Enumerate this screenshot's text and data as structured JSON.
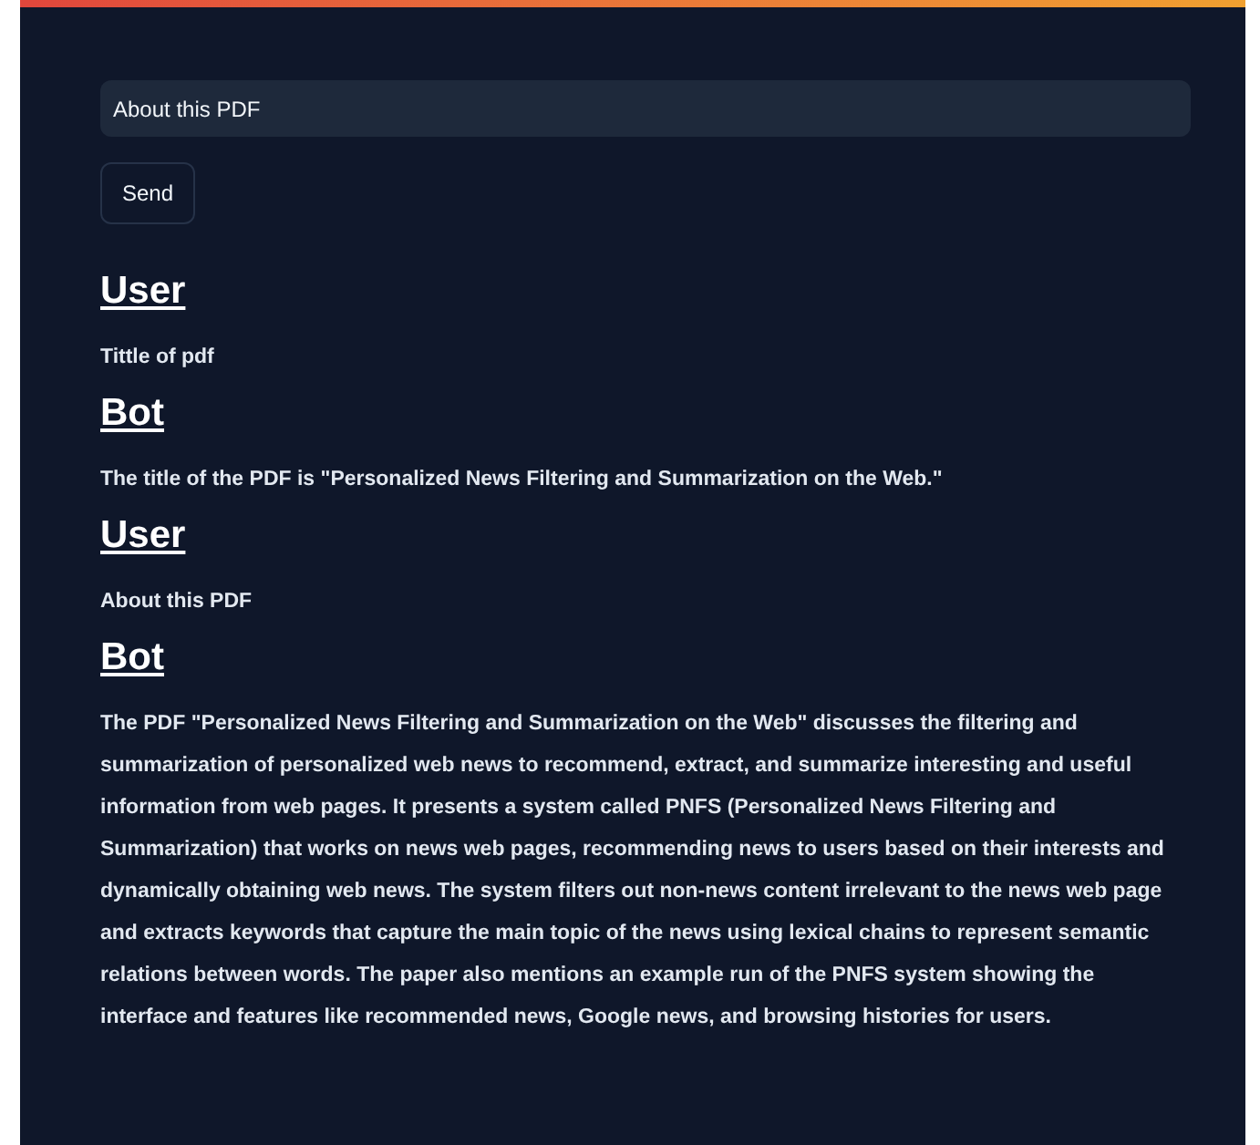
{
  "input": {
    "value": "About this PDF"
  },
  "send_button": {
    "label": "Send"
  },
  "messages": [
    {
      "speaker": "User",
      "text": "Tittle of pdf"
    },
    {
      "speaker": "Bot",
      "text": "The title of the PDF is \"Personalized News Filtering and Summarization on the Web.\""
    },
    {
      "speaker": "User",
      "text": "About this PDF"
    },
    {
      "speaker": "Bot",
      "text": "The PDF \"Personalized News Filtering and Summarization on the Web\" discusses the filtering and summarization of personalized web news to recommend, extract, and summarize interesting and useful information from web pages. It presents a system called PNFS (Personalized News Filtering and Summarization) that works on news web pages, recommending news to users based on their interests and dynamically obtaining web news. The system filters out non-news content irrelevant to the news web page and extracts keywords that capture the main topic of the news using lexical chains to represent semantic relations between words. The paper also mentions an example run of the PNFS system showing the interface and features like recommended news, Google news, and browsing histories for users."
    }
  ]
}
